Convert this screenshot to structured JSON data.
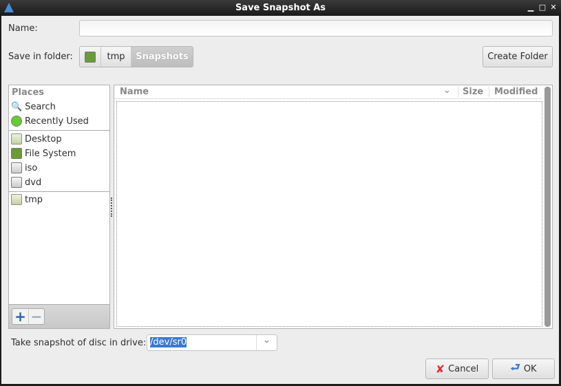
{
  "window": {
    "title": "Save Snapshot As",
    "minimize": "▁",
    "maximize": "□",
    "close": "✕"
  },
  "form": {
    "name_label": "Name:",
    "name_value": "",
    "folder_label": "Save in folder:",
    "path": [
      "tmp",
      "Snapshots"
    ],
    "create_folder": "Create Folder"
  },
  "places": {
    "header": "Places",
    "items": [
      {
        "label": "Search"
      },
      {
        "label": "Recently Used"
      },
      {
        "label": "Desktop"
      },
      {
        "label": "File System"
      },
      {
        "label": "iso"
      },
      {
        "label": "dvd"
      },
      {
        "label": "tmp"
      }
    ],
    "add": "+",
    "remove": "−"
  },
  "files": {
    "columns": {
      "name": "Name",
      "size": "Size",
      "modified": "Modified"
    }
  },
  "drive": {
    "label": "Take snapshot of disc in drive:",
    "value": "/dev/sr0"
  },
  "buttons": {
    "cancel": "Cancel",
    "ok": "OK"
  }
}
